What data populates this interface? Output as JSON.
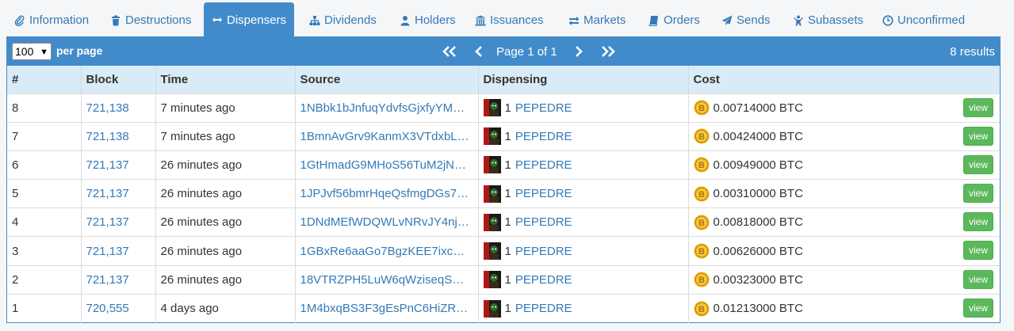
{
  "tabs": [
    {
      "label": "Information",
      "icon": "paperclip-icon"
    },
    {
      "label": "Destructions",
      "icon": "trash-icon"
    },
    {
      "label": "Dispensers",
      "icon": "double-arrow-icon"
    },
    {
      "label": "Dividends",
      "icon": "sitemap-icon"
    },
    {
      "label": "Holders",
      "icon": "user-icon"
    },
    {
      "label": "Issuances",
      "icon": "bank-icon"
    },
    {
      "label": "Markets",
      "icon": "exchange-icon"
    },
    {
      "label": "Orders",
      "icon": "book-icon"
    },
    {
      "label": "Sends",
      "icon": "paper-plane-icon"
    },
    {
      "label": "Subassets",
      "icon": "child-icon"
    },
    {
      "label": "Unconfirmed",
      "icon": "clock-icon"
    }
  ],
  "active_tab": "Dispensers",
  "toolbar": {
    "per_page_value": "100",
    "per_page_label": "per page",
    "page_text": "Page 1 of 1",
    "results_text": "8 results"
  },
  "columns": [
    "#",
    "Block",
    "Time",
    "Source",
    "Dispensing",
    "Cost"
  ],
  "rows": [
    {
      "num": "8",
      "block": "721,138",
      "time": "7 minutes ago",
      "source": "1NBbk1bJnfuqYdvfsGjxfyYM…",
      "qty": "1",
      "asset": "PEPEDRE",
      "cost": "0.00714000 BTC",
      "action": "view"
    },
    {
      "num": "7",
      "block": "721,138",
      "time": "7 minutes ago",
      "source": "1BmnAvGrv9KanmX3VTdxbL…",
      "qty": "1",
      "asset": "PEPEDRE",
      "cost": "0.00424000 BTC",
      "action": "view"
    },
    {
      "num": "6",
      "block": "721,137",
      "time": "26 minutes ago",
      "source": "1GtHmadG9MHoS56TuM2jN…",
      "qty": "1",
      "asset": "PEPEDRE",
      "cost": "0.00949000 BTC",
      "action": "view"
    },
    {
      "num": "5",
      "block": "721,137",
      "time": "26 minutes ago",
      "source": "1JPJvf56bmrHqeQsfmgDGs7…",
      "qty": "1",
      "asset": "PEPEDRE",
      "cost": "0.00310000 BTC",
      "action": "view"
    },
    {
      "num": "4",
      "block": "721,137",
      "time": "26 minutes ago",
      "source": "1DNdMEfWDQWLvNRvJY4nj…",
      "qty": "1",
      "asset": "PEPEDRE",
      "cost": "0.00818000 BTC",
      "action": "view"
    },
    {
      "num": "3",
      "block": "721,137",
      "time": "26 minutes ago",
      "source": "1GBxRe6aaGo7BgzKEE7ixc…",
      "qty": "1",
      "asset": "PEPEDRE",
      "cost": "0.00626000 BTC",
      "action": "view"
    },
    {
      "num": "2",
      "block": "721,137",
      "time": "26 minutes ago",
      "source": "18VTRZPH5LuW6qWziseqS…",
      "qty": "1",
      "asset": "PEPEDRE",
      "cost": "0.00323000 BTC",
      "action": "view"
    },
    {
      "num": "1",
      "block": "720,555",
      "time": "4 days ago",
      "source": "1M4bxqBS3F3gEsPnC6HiZR…",
      "qty": "1",
      "asset": "PEPEDRE",
      "cost": "0.01213000 BTC",
      "action": "view"
    }
  ],
  "colors": {
    "accent": "#428bca",
    "link": "#337ab7",
    "header_bg": "#d9ebf7",
    "view_button": "#5cb85c"
  }
}
